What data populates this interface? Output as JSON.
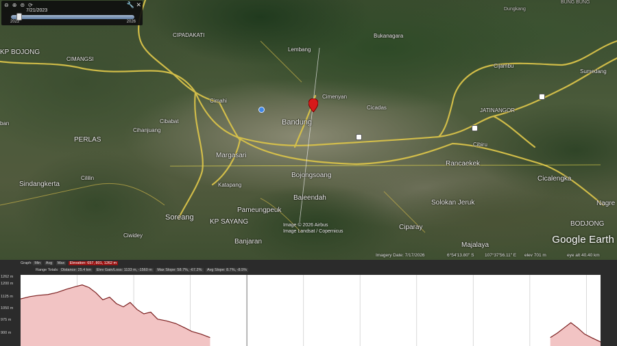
{
  "time_slider": {
    "date": "7/21/2023",
    "start_year": "2022",
    "end_year": "2026",
    "tools": [
      "zoom-out-icon",
      "zoom-in-icon",
      "zoom-reset-icon",
      "play-icon"
    ]
  },
  "map": {
    "labels": {
      "cimahi": "Cimahi",
      "bandung": "Bandung",
      "cimenyan": "Cimenyan",
      "cimindi": "Cimindi",
      "cilengkrang": "Cilengkrang",
      "cipadakati": "CIPADAKATI",
      "bukanagara": "Bukanagara",
      "dungkang": "Dungkang",
      "lembang": "Lembang",
      "cimangsi": "CIMANGSI",
      "cicadas": "Cicadas",
      "cibabat": "Cibabat",
      "cimahi2": "Cimahi",
      "cihanjuang": "Cihanjuang",
      "perlas": "PERLAS",
      "margasari": "Margasari",
      "sindangkerta": "Sindangkerta",
      "cililin": "Cililin",
      "katapang": "Katapang",
      "soreang": "Soreang",
      "pameungpeuk": "Pameungpeuk",
      "kp_sayang": "KP SAYANG",
      "bojongsoang": "Bojongsoang",
      "baleendah": "Baleendah",
      "banjaran": "Banjaran",
      "majalaya": "Majalaya",
      "ciparay": "Ciparay",
      "solokan_jeruk": "Solokan Jeruk",
      "rancaekek": "Rancaekek",
      "cicalengka": "Cicalengka",
      "bodjong": "BODJONG",
      "jatinangor": "JATINANGOR",
      "nagreg": "Nagre",
      "cibiru": "Cibiru",
      "kpbojong": "KP BOJONG",
      "bunglon": "BUNG BUNG",
      "ban": "ban",
      "ciwidey": "Ciwidey",
      "sumedang": "Sumedang",
      "cijambu": "Cijambu",
      "bandung_edge": "Bandung"
    },
    "copyright": [
      "Image © 2026 Airbus",
      "Image Landsat / Copernicus"
    ],
    "logo": "Google Earth"
  },
  "status_bar": {
    "imagery_date": "Imagery Date: 7/17/2026",
    "lat": "6°54'13.80\" S",
    "lon": "107°37'56.11\" E",
    "elev": "elev  701 m",
    "eye_alt": "eye alt  40.40 km"
  },
  "profile": {
    "row1": {
      "graph": "Graph:",
      "min": "Min",
      "avg": "Avg",
      "max": "Max",
      "elevation": "Elevation: 657, 801, 1262 m"
    },
    "row2": {
      "range_totals": "Range Totals:",
      "distance": "Distance: 25.4 km",
      "gain_loss": "Elev Gain/Loss: 1133 m, -1560 m",
      "max_slope": "Max Slope: 58.7%, -67.2%",
      "avg_slope": "Avg Slope: 8.7%, -8.5%"
    },
    "y_ticks": [
      "1262 m",
      "1200 m",
      "1125 m",
      "1050 m",
      "975 m",
      "900 m"
    ]
  },
  "chart_data": {
    "type": "area",
    "title": "",
    "xlabel": "",
    "ylabel": "",
    "ylim": [
      857,
      1262
    ],
    "xlim": [
      0,
      25.4
    ],
    "x": [
      0,
      0.4,
      0.8,
      1.2,
      1.6,
      2.0,
      2.4,
      2.7,
      3.0,
      3.3,
      3.6,
      3.9,
      4.2,
      4.5,
      4.8,
      5.1,
      5.4,
      5.7,
      6.0,
      6.4,
      6.8,
      7.2,
      7.5,
      7.9,
      8.3,
      23.2,
      23.5,
      23.8,
      24.1,
      24.4,
      24.7,
      25.0,
      25.4
    ],
    "y": [
      1125,
      1138,
      1146,
      1150,
      1162,
      1180,
      1195,
      1205,
      1190,
      1160,
      1120,
      1135,
      1098,
      1080,
      1105,
      1065,
      1040,
      1050,
      1010,
      1000,
      985,
      960,
      940,
      925,
      905,
      905,
      930,
      960,
      990,
      960,
      925,
      905,
      880
    ],
    "series": [
      {
        "values": "y"
      }
    ],
    "colors": {
      "fill": "#f2c4c4",
      "line": "#7a1d1d"
    },
    "grid": true,
    "visible_x_range_km": [
      0,
      25.4
    ]
  }
}
